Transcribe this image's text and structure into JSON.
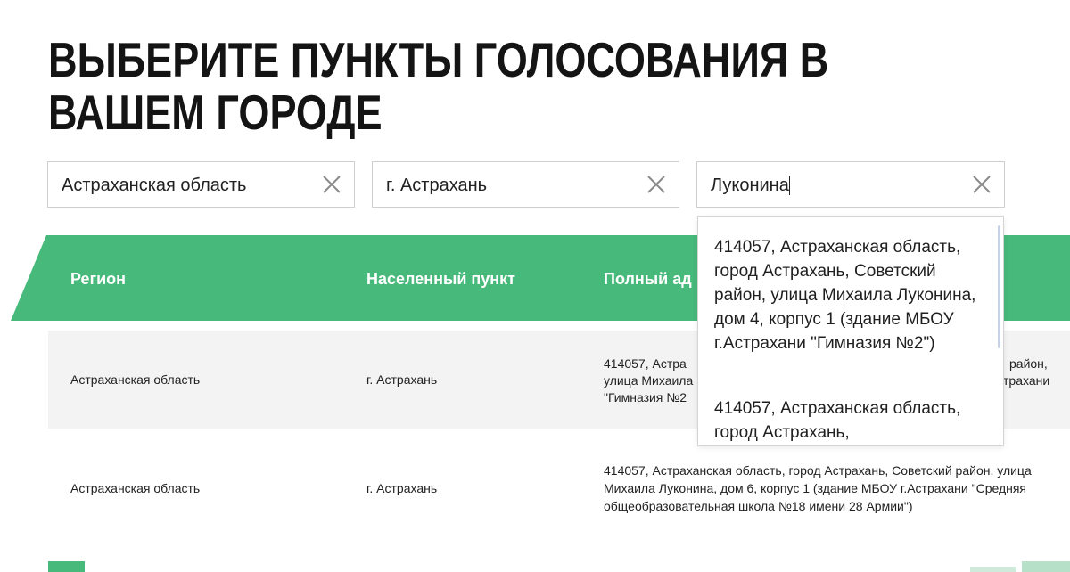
{
  "page": {
    "title": "ВЫБЕРИТЕ ПУНКТЫ ГОЛОСОВАНИЯ В ВАШЕМ ГОРОДЕ"
  },
  "filters": {
    "region": {
      "value": "Астраханская область"
    },
    "city": {
      "value": "г. Астрахань"
    },
    "search": {
      "value": "Луконина"
    }
  },
  "table": {
    "headers": [
      "Регион",
      "Населенный пункт",
      "Полный ад"
    ],
    "rows": [
      {
        "region": "Астраханская область",
        "city": "г. Астрахань",
        "address_line1": "414057, Астра",
        "address_line2": "улица Михаила",
        "address_line3": "\"Гимназия №2",
        "address_right1": "район,",
        "address_right2": "трахани"
      },
      {
        "region": "Астраханская область",
        "city": "г. Астрахань",
        "address": "414057, Астраханская область, город Астрахань, Советский район, улица Михаила Луконина, дом 6, корпус 1 (здание МБОУ г.Астрахани \"Средняя общеобразовательная школа №18 имени 28 Армии\")"
      }
    ]
  },
  "dropdown": {
    "options": [
      "414057, Астраханская область, город Астрахань, Советский район, улица Михаила Луконина, дом 4, корпус 1 (здание МБОУ г.Астрахани \"Гимназия №2\")",
      "414057, Астраханская область, город Астрахань,"
    ]
  },
  "colors": {
    "accent": "#47b97a",
    "row_alt": "#f3f3f3"
  },
  "icons": {
    "clear": "close-icon"
  }
}
